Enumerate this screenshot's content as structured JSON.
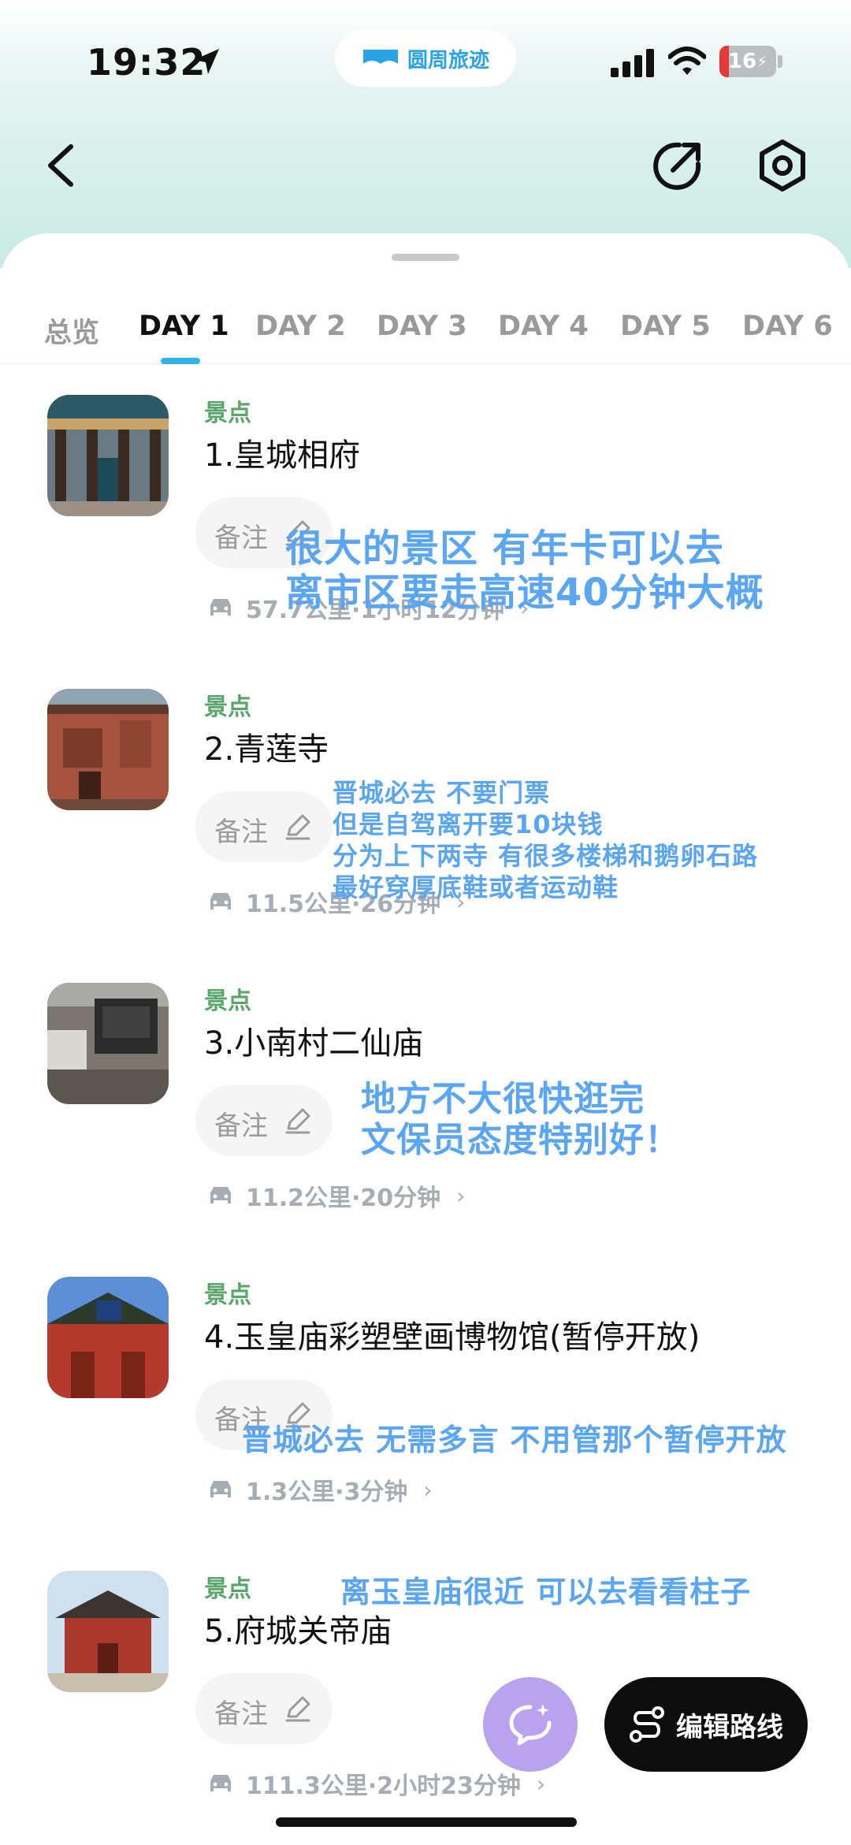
{
  "status": {
    "time": "19:32",
    "app_name": "圆周旅迹",
    "battery_level": "16",
    "battery_fraction": 0.16
  },
  "tabs": [
    "总览",
    "DAY 1",
    "DAY 2",
    "DAY 3",
    "DAY 4",
    "DAY 5",
    "DAY 6"
  ],
  "active_tab": "DAY 1",
  "items": [
    {
      "category": "景点",
      "title": "1.皇城相府",
      "note_label": "备注",
      "route": "57.7公里·1小时12分钟",
      "annotation": [
        "很大的景区 有年卡可以去",
        "离市区要走高速40分钟大概"
      ]
    },
    {
      "category": "景点",
      "title": "2.青莲寺",
      "note_label": "备注",
      "route": "11.5公里·26分钟",
      "annotation": [
        "晋城必去 不要门票",
        "但是自驾离开要10块钱",
        "分为上下两寺 有很多楼梯和鹅卵石路",
        "最好穿厚底鞋或者运动鞋"
      ]
    },
    {
      "category": "景点",
      "title": "3.小南村二仙庙",
      "note_label": "备注",
      "route": "11.2公里·20分钟",
      "annotation": [
        "地方不大很快逛完",
        "文保员态度特别好！"
      ]
    },
    {
      "category": "景点",
      "title": "4.玉皇庙彩塑壁画博物馆(暂停开放)",
      "note_label": "备注",
      "route": "1.3公里·3分钟",
      "annotation": [
        "晋城必去 无需多言 不用管那个暂停开放"
      ]
    },
    {
      "category": "景点",
      "title": "5.府城关帝庙",
      "note_label": "备注",
      "route": "111.3公里·2小时23分钟",
      "annotation": [
        "离玉皇庙很近 可以去看看柱子"
      ]
    }
  ],
  "buttons": {
    "edit_route": "编辑路线"
  },
  "colors": {
    "accent": "#2fb3e8",
    "category": "#5aa56a",
    "annotation": "#5aa6f5",
    "ai_button": "#b9a3ee"
  }
}
